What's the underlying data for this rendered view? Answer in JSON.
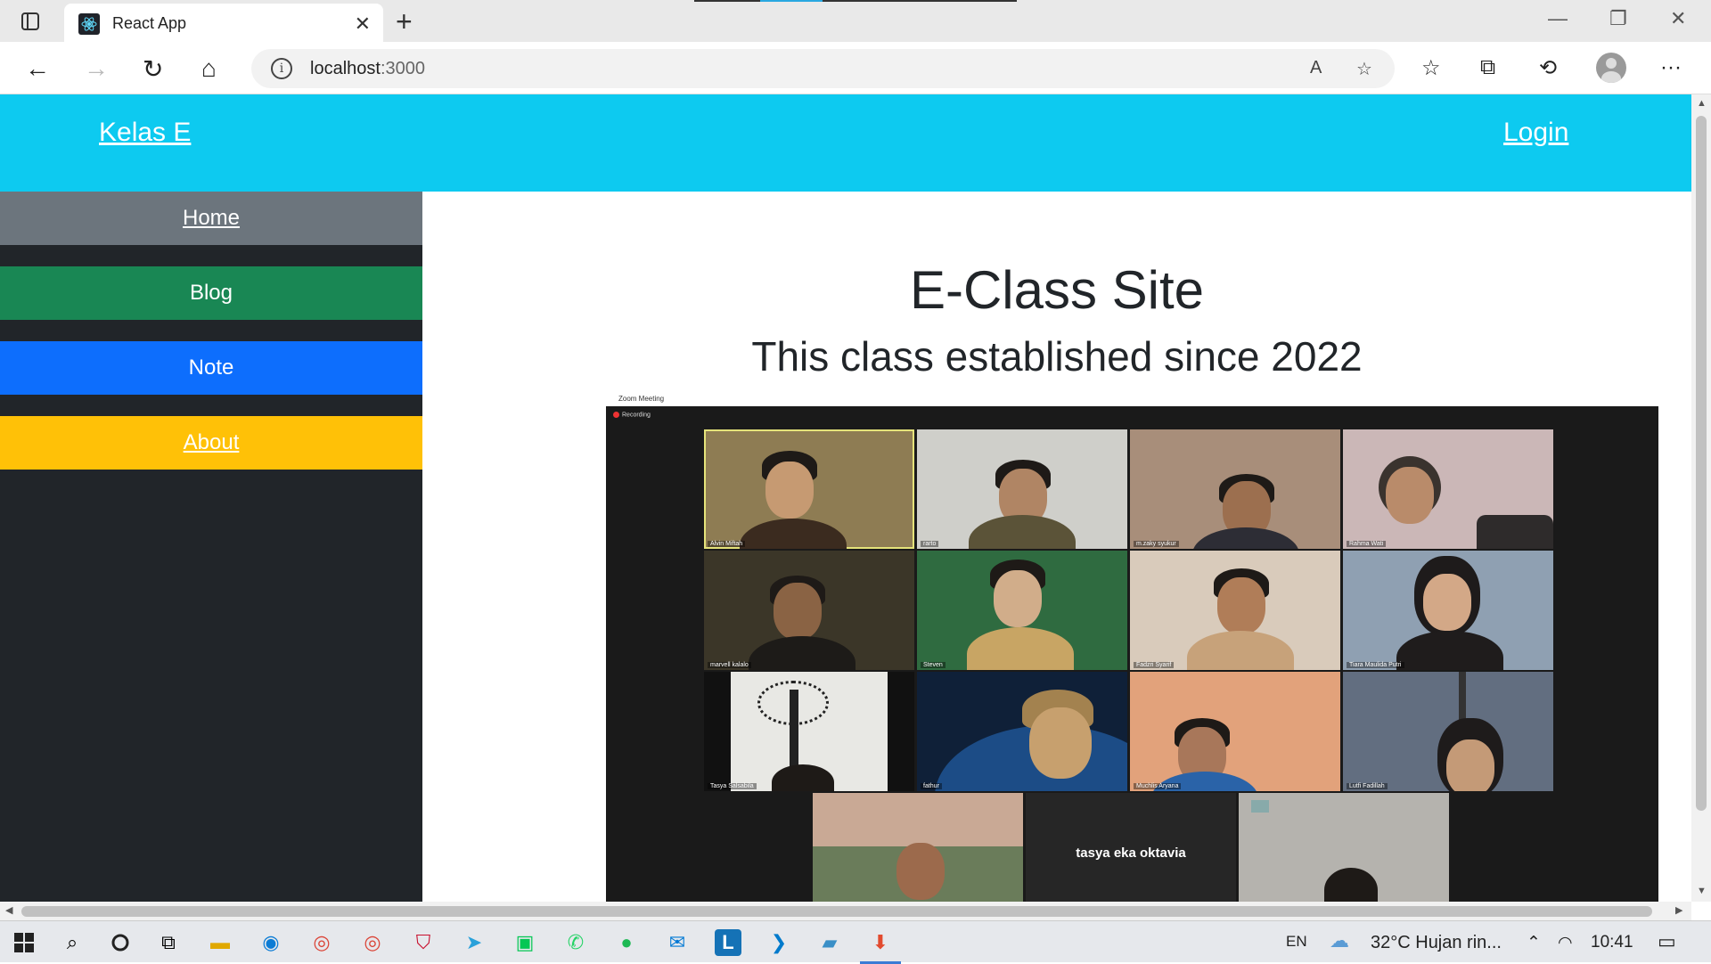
{
  "browser": {
    "tab_title": "React App",
    "url_host": "localhost",
    "url_port": ":3000"
  },
  "page": {
    "brand": "Kelas E",
    "login": "Login",
    "sidebar": [
      {
        "label": "Home",
        "color": "#6c757d"
      },
      {
        "label": "Blog",
        "color": "#198754"
      },
      {
        "label": "Note",
        "color": "#0d6efd"
      },
      {
        "label": "About",
        "color": "#ffc107"
      }
    ],
    "heading": "E-Class Site",
    "subheading": "This class established since 2022"
  },
  "zoom": {
    "window_title": "Zoom Meeting",
    "recording": "Recording",
    "participants": [
      "Alvin Miftah",
      "rarto",
      "m.zaky syukur",
      "Rahma Wati",
      "marvell kalalo",
      "Steven",
      "Fadzri Syarif",
      "Tiara Maulida Putri",
      "Tasya Salsabila",
      "fathur",
      "Muchlis Aryana",
      "Lutfi Fadillah"
    ],
    "text_tile": "tasya eka oktavia"
  },
  "taskbar": {
    "lang": "EN",
    "weather": "32°C  Hujan rin...",
    "time": "10:41"
  }
}
